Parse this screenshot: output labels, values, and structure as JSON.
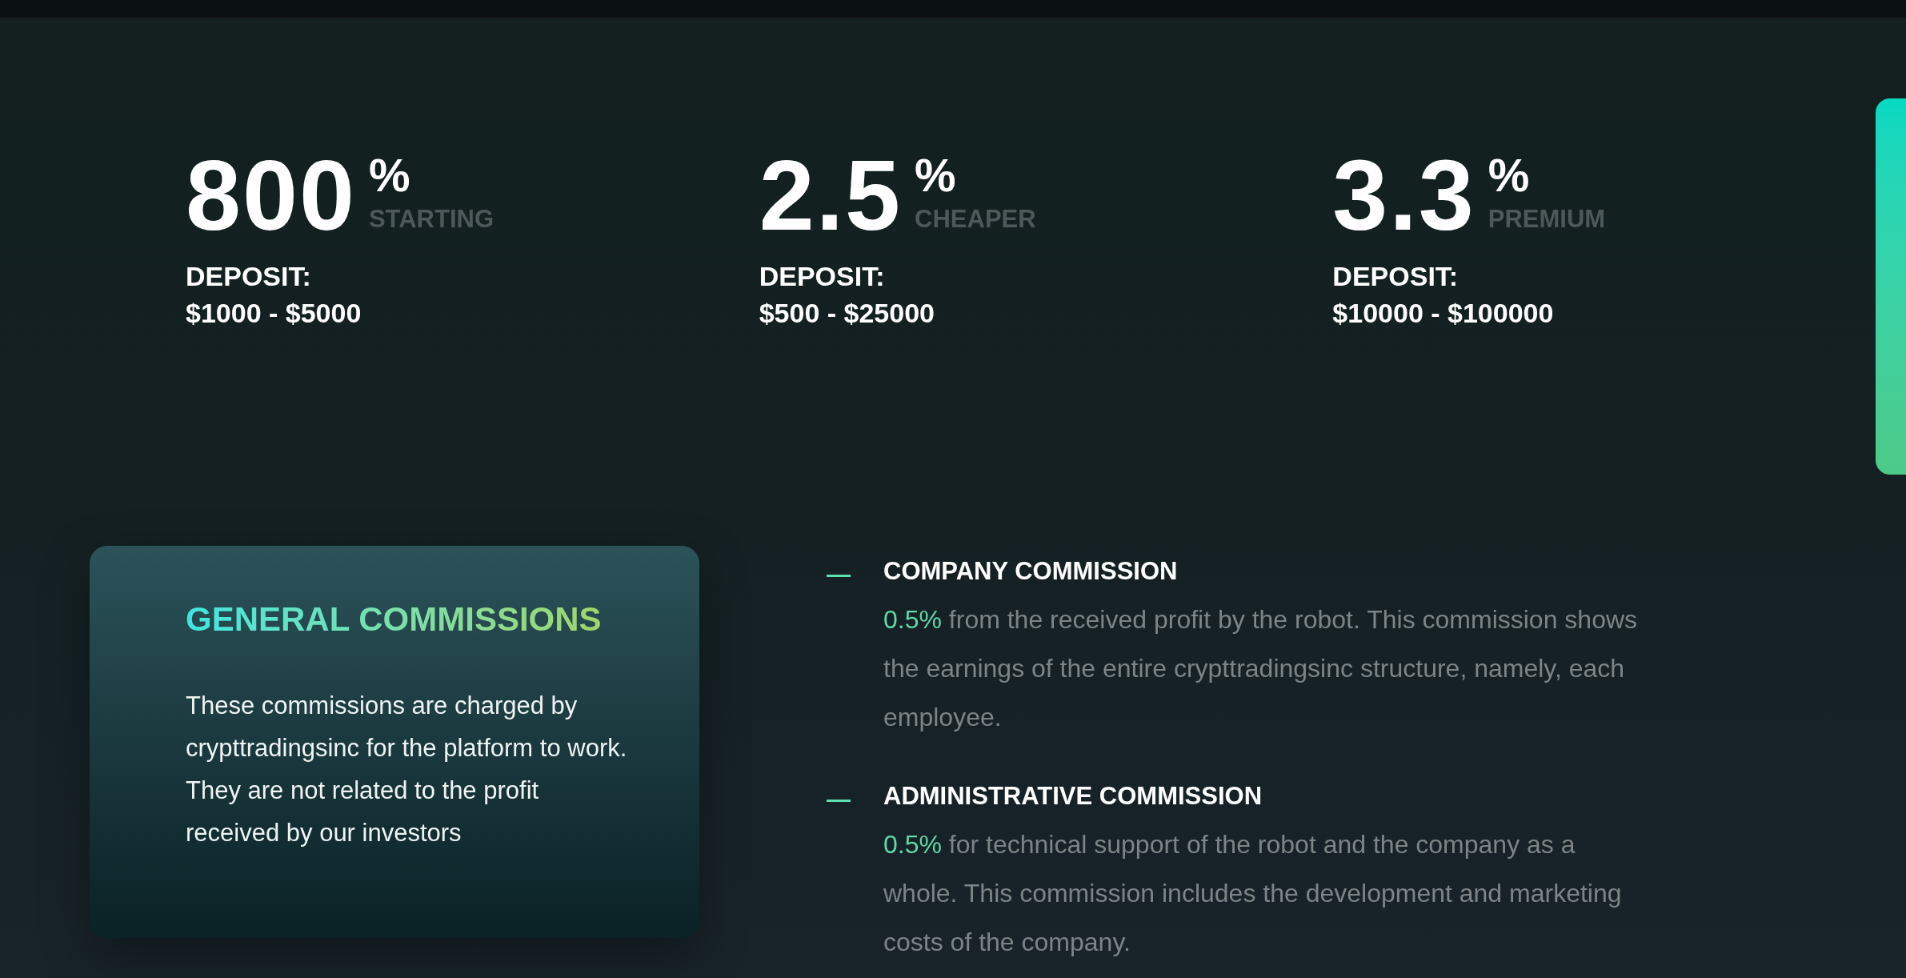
{
  "stats": [
    {
      "value": "800",
      "suffix": "%",
      "label": "STARTING",
      "deposit_label": "DEPOSIT:",
      "deposit_range": "$1000 - $5000"
    },
    {
      "value": "2.5",
      "suffix": "%",
      "label": "CHEAPER",
      "deposit_label": "DEPOSIT:",
      "deposit_range": "$500 - $25000"
    },
    {
      "value": "3.3",
      "suffix": "%",
      "label": "PREMIUM",
      "deposit_label": "DEPOSIT:",
      "deposit_range": "$10000 - $100000"
    }
  ],
  "general_card": {
    "title": "GENERAL COMMISSIONS",
    "text": "These commissions are charged by crypttradingsinc for the platform to work. They are not related to the profit received by our investors"
  },
  "commissions": [
    {
      "title": "COMPANY COMMISSION",
      "highlight": "0.5%",
      "text": "from the received profit by the robot. This commission shows the earnings of the entire crypttradingsinc structure, namely, each employee."
    },
    {
      "title": "ADMINISTRATIVE COMMISSION",
      "highlight": "0.5%",
      "text": "for technical support of the robot and the company as a whole. This commission includes the development and marketing costs of the company."
    }
  ]
}
